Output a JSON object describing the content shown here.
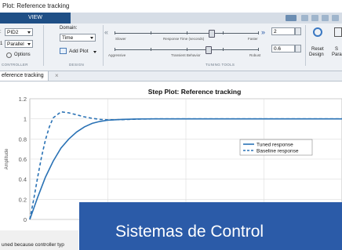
{
  "window": {
    "title": "Plot: Reference tracking"
  },
  "ribbon": {
    "tab_view": "VIEW",
    "controller": {
      "type_value": "PID2",
      "form_value": "Parallel",
      "options_label": "Options",
      "section_label": "CONTROLLER"
    },
    "design": {
      "domain_label": "Domain:",
      "domain_value": "Time",
      "add_plot_label": "Add Plot",
      "section_label": "DESIGN"
    },
    "tuning": {
      "response_slower": "Slower",
      "response_label": "Response Time (seconds)",
      "response_faster": "Faster",
      "transient_aggressive": "Aggressive",
      "transient_label": "Transient Behavior",
      "transient_robust": "Robust",
      "response_value": "2",
      "transient_value": "0.6",
      "section_label": "TUNING TOOLS"
    },
    "actions": {
      "reset_label": "Reset",
      "design_label": "Design",
      "save_label": "S",
      "params_label": "Para"
    }
  },
  "doc_tab": {
    "label": "eference tracking"
  },
  "chart_data": {
    "type": "line",
    "title": "Step Plot: Reference tracking",
    "ylabel": "Amplitude",
    "ylim": [
      0,
      1.2
    ],
    "yticks": [
      "0",
      "0.2",
      "0.4",
      "0.6",
      "0.8",
      "1",
      "1.2"
    ],
    "grid": true,
    "legend_position": "right",
    "series": [
      {
        "name": "Tuned response",
        "style": "solid",
        "color": "#2a72b5",
        "x": [
          0,
          0.5,
          1,
          1.5,
          2,
          2.5,
          3,
          3.5,
          4,
          4.5,
          5,
          6,
          7,
          8,
          10,
          12,
          14,
          16,
          18,
          20
        ],
        "y": [
          0,
          0.22,
          0.42,
          0.58,
          0.71,
          0.8,
          0.87,
          0.92,
          0.955,
          0.975,
          0.987,
          0.995,
          0.999,
          1,
          1,
          1,
          1,
          1,
          1,
          1
        ]
      },
      {
        "name": "Baseline response",
        "style": "dashed",
        "color": "#2a72b5",
        "x": [
          0,
          0.25,
          0.5,
          0.75,
          1,
          1.25,
          1.5,
          2,
          2.5,
          3,
          3.5,
          4,
          4.5,
          5,
          6,
          7,
          8,
          10,
          12,
          14,
          16,
          18,
          20
        ],
        "y": [
          0,
          0.2,
          0.42,
          0.62,
          0.79,
          0.92,
          1.01,
          1.07,
          1.06,
          1.04,
          1.02,
          1.005,
          0.995,
          0.99,
          0.993,
          0.998,
          1,
          1,
          1,
          1,
          1,
          1,
          1
        ]
      }
    ]
  },
  "status": {
    "text": "uned because controller typ"
  },
  "banner": {
    "text": "Sistemas de Control"
  }
}
